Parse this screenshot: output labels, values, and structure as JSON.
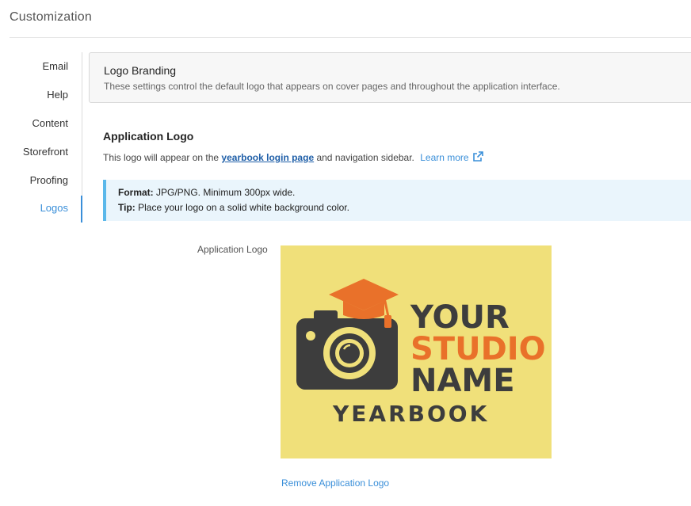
{
  "page": {
    "title": "Customization"
  },
  "sidebar": {
    "items": [
      {
        "label": "Email"
      },
      {
        "label": "Help"
      },
      {
        "label": "Content"
      },
      {
        "label": "Storefront"
      },
      {
        "label": "Proofing"
      },
      {
        "label": "Logos"
      }
    ],
    "active": "Logos"
  },
  "branding": {
    "title": "Logo Branding",
    "description": "These settings control the default logo that appears on cover pages and throughout the application interface."
  },
  "app_logo": {
    "title": "Application Logo",
    "desc_prefix": "This logo will appear on the ",
    "desc_link": "yearbook login page",
    "desc_suffix": " and navigation sidebar.",
    "learn_more": "Learn more",
    "info": {
      "format_label": "Format:",
      "format_text": " JPG/PNG. Minimum 300px wide.",
      "tip_label": "Tip:",
      "tip_text": " Place your logo on a solid white background color."
    },
    "field_label": "Application Logo",
    "remove_label": "Remove Application Logo",
    "logo_image": {
      "line1": "YOUR",
      "line2": "STUDIO",
      "line3": "NAME",
      "line4": "YEARBOOK",
      "bg_color": "#f0e07a",
      "dark_color": "#3d3d3d",
      "accent_color": "#e9712a",
      "icon": "camera-with-graduation-cap-icon"
    }
  },
  "colors": {
    "accent": "#3a8fd9",
    "info_border": "#5bb8ea",
    "info_bg": "#eaf5fc"
  }
}
